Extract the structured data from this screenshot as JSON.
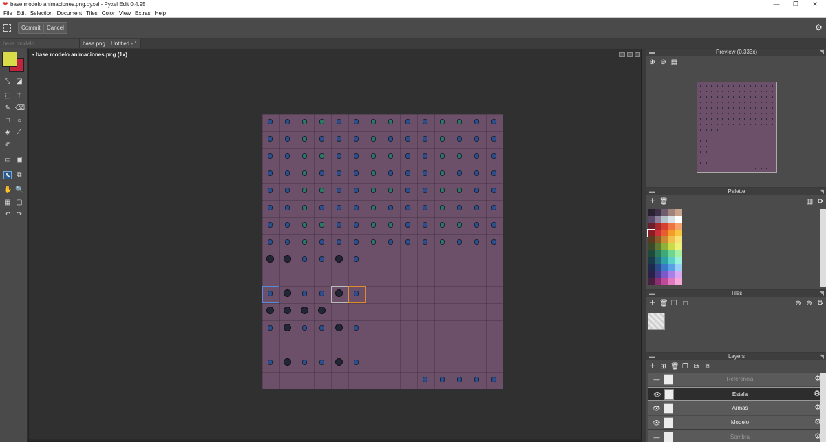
{
  "window": {
    "title": "base modelo animaciones.png.pyxel - Pyxel Edit 0.4.95",
    "minimize": "—",
    "maximize": "❐",
    "close": "✕"
  },
  "menu": [
    "File",
    "Edit",
    "Selection",
    "Document",
    "Tiles",
    "Color",
    "View",
    "Extras",
    "Help"
  ],
  "toolbar": {
    "commit_label": "Commit",
    "cancel_label": "Cancel"
  },
  "tabs": [
    {
      "label": "base modelo animaciones.png"
    },
    {
      "label": "base.png"
    },
    {
      "label": "Untitled - 1"
    }
  ],
  "colors": {
    "primary": "#d7dc48",
    "secondary": "#c0243e",
    "canvas_bg": "#6c5069"
  },
  "document": {
    "title": "• base modelo animaciones.png   (1x)"
  },
  "preview": {
    "title": "Preview (0.333x)"
  },
  "palette": {
    "title": "Palette",
    "colors": [
      [
        "#2a2030",
        "#3f3147",
        "#6d5b6e",
        "#a0837a",
        "#c9a48c"
      ],
      [
        "#5a4a6a",
        "#8e7f9a",
        "#b3c1c9",
        "#d8e2e6",
        "#ffffff"
      ],
      [
        "#6b1f2b",
        "#a52a30",
        "#d6402e",
        "#ef7444",
        "#f7a36a"
      ],
      [
        "#8a1d24",
        "#cc2e3a",
        "#e85d2f",
        "#f49b2a",
        "#f7c640"
      ],
      [
        "#5a3a20",
        "#8a5a28",
        "#c98a32",
        "#f0c04a",
        "#f7e27a"
      ],
      [
        "#3c4a2a",
        "#5e7a30",
        "#8fb03a",
        "#c8dc4a",
        "#eef27a"
      ],
      [
        "#1f4a3a",
        "#2e7a5a",
        "#3ea878",
        "#6ed690",
        "#a6f0a0"
      ],
      [
        "#1a3a4a",
        "#236a7a",
        "#2ea0a8",
        "#5ad0c6",
        "#9cf0de"
      ],
      [
        "#1e2a4a",
        "#2a4a8a",
        "#3a78c8",
        "#5aa0e6",
        "#9ad0f6"
      ],
      [
        "#2a2048",
        "#4a3a8a",
        "#7a5ac8",
        "#a880e6",
        "#d8a8f2"
      ],
      [
        "#4a2040",
        "#8a3070",
        "#c04a9a",
        "#e07ac0",
        "#f6a8da"
      ]
    ]
  },
  "tiles": {
    "title": "Tiles"
  },
  "layers": {
    "title": "Layers",
    "items": [
      {
        "name": "Referencia",
        "visibility": "—",
        "dim": true,
        "selected": false
      },
      {
        "name": "Estela",
        "visibility": "👁",
        "dim": false,
        "selected": true
      },
      {
        "name": "Armas",
        "visibility": "👁",
        "dim": false,
        "selected": false
      },
      {
        "name": "Modelo",
        "visibility": "👁",
        "dim": false,
        "selected": false
      },
      {
        "name": "Sombra",
        "visibility": "—",
        "dim": true,
        "selected": false
      }
    ]
  }
}
